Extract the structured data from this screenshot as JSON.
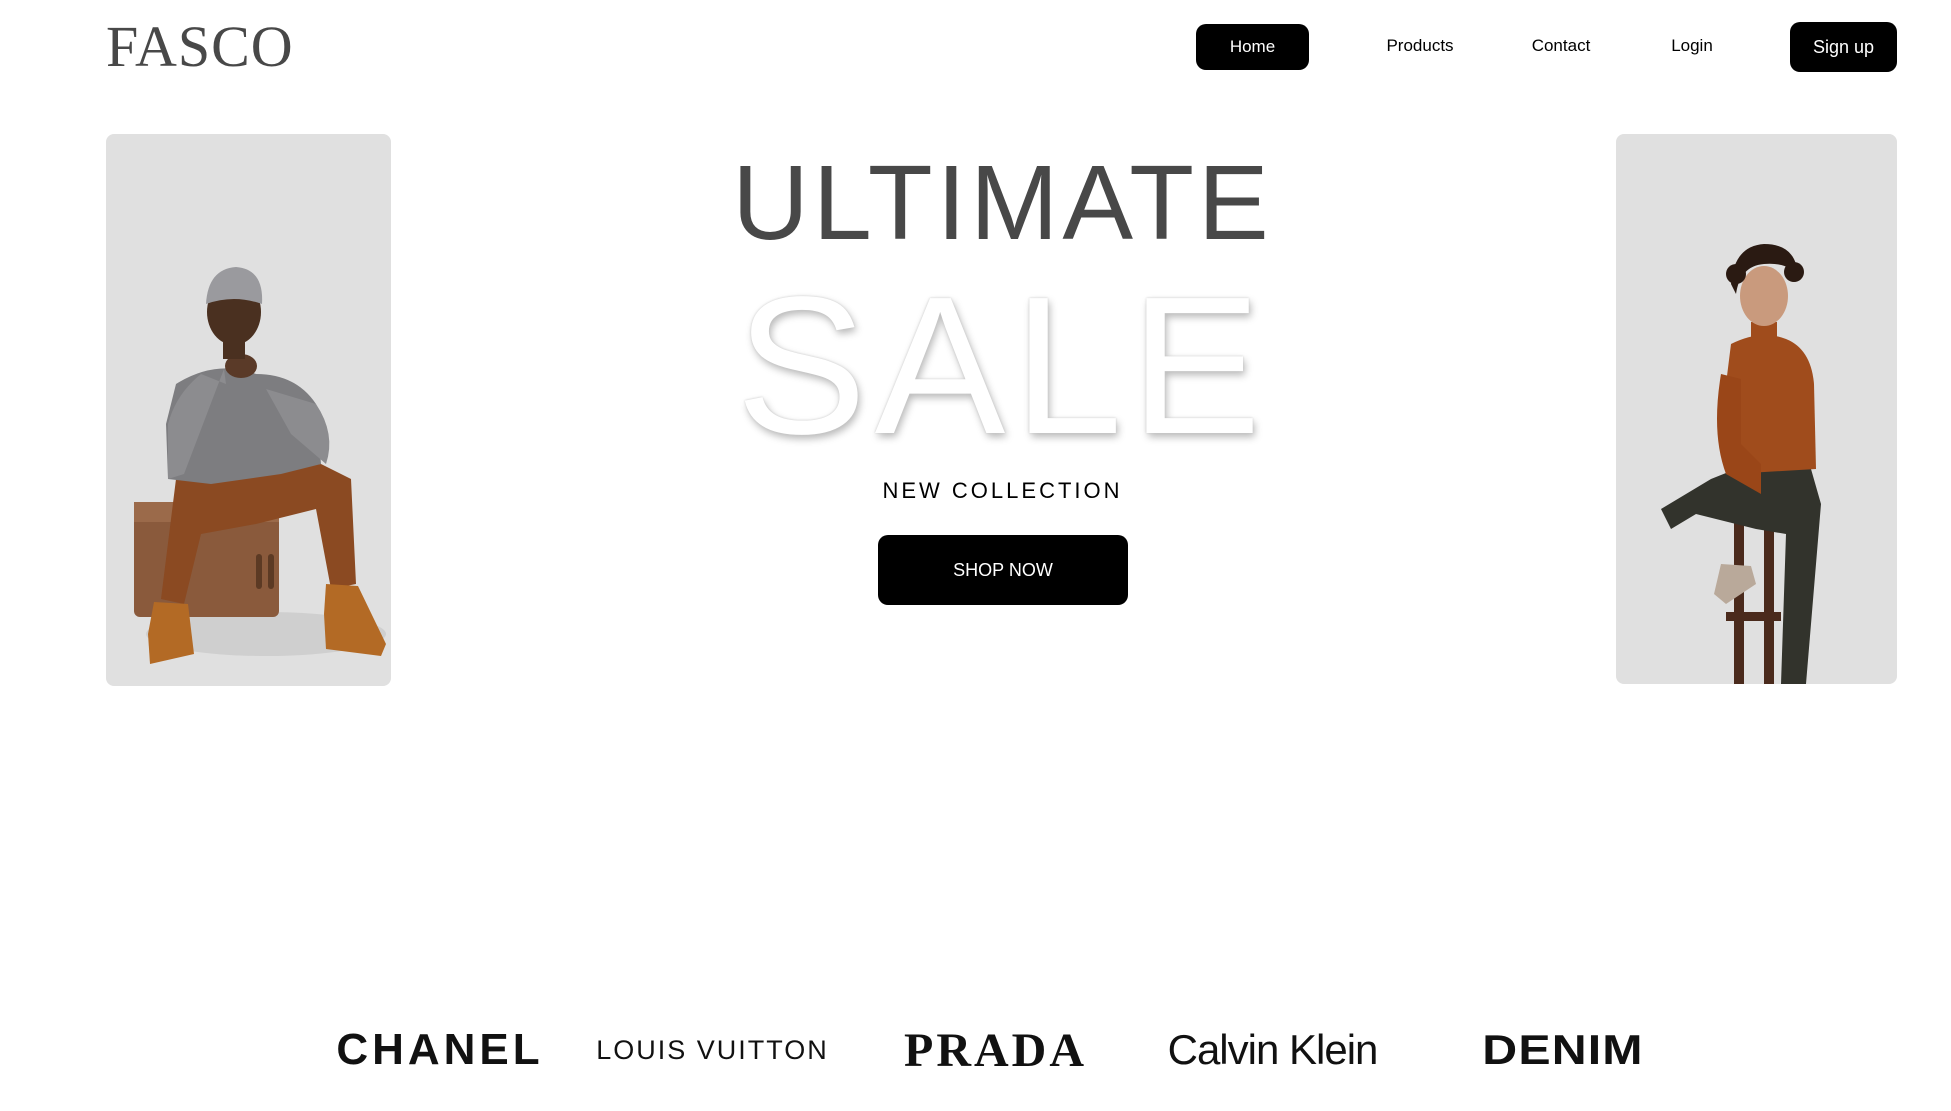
{
  "header": {
    "logo": "FASCO",
    "nav": {
      "home": "Home",
      "products": "Products",
      "contact": "Contact",
      "login": "Login",
      "signup": "Sign up"
    }
  },
  "hero": {
    "title_line1": "ULTIMATE",
    "title_line2": "SALE",
    "subtitle": "NEW COLLECTION",
    "cta": "SHOP NOW",
    "left_image": "model seated on wooden crate",
    "right_image": "model seated on bar stool"
  },
  "brands": [
    "CHANEL",
    "LOUIS VUITTON",
    "PRADA",
    "Calvin Klein",
    "DENIM"
  ],
  "colors": {
    "primary": "#000000",
    "text_gray": "#484848",
    "panel_bg": "#e0e0e0",
    "background": "#ffffff"
  }
}
